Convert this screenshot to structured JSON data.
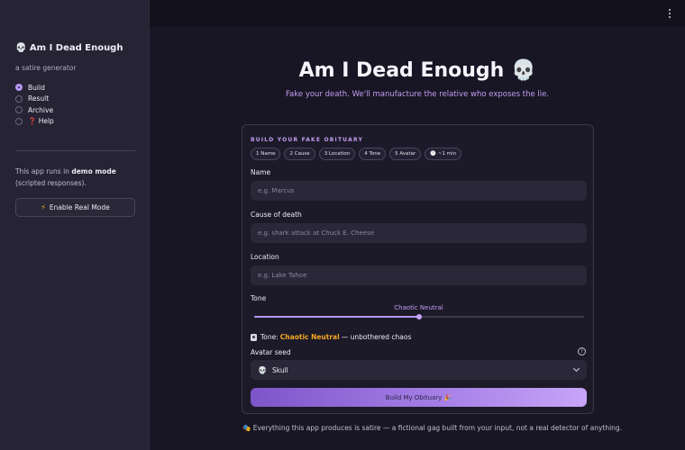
{
  "sidebar": {
    "title": "💀 Am I Dead Enough",
    "subtitle": "a satire generator",
    "nav": [
      {
        "label": "Build",
        "selected": true
      },
      {
        "label": "Result",
        "selected": false
      },
      {
        "label": "Archive",
        "selected": false
      },
      {
        "label": "❓ Help",
        "selected": false
      }
    ],
    "note_prefix": "This app runs in ",
    "note_bold": "demo mode",
    "note_suffix": " (scripted responses).",
    "enable_button": "Enable Real Mode",
    "enable_icon": "⚡"
  },
  "header": {
    "menu_icon": "kebab-menu-icon"
  },
  "hero": {
    "title": "Am I Dead Enough 💀",
    "subtitle": "Fake your death. We'll manufacture the relative who exposes the lie."
  },
  "form": {
    "heading": "BUILD YOUR FAKE OBITUARY",
    "steps": [
      "1 Name",
      "2 Cause",
      "3 Location",
      "4 Tone",
      "5 Avatar",
      "🕐 ~1 min"
    ],
    "name_label": "Name",
    "name_placeholder": "e.g. Marcus",
    "name_value": "",
    "cause_label": "Cause of death",
    "cause_placeholder": "e.g. shark attack at Chuck E. Cheese",
    "cause_value": "",
    "location_label": "Location",
    "location_placeholder": "e.g. Lake Tahoe",
    "location_value": "",
    "tone_label": "Tone",
    "tone_value": "Chaotic Neutral",
    "tone_level": 0.5,
    "tone_line_prefix": "Tone:",
    "tone_line_name": "Chaotic Neutral",
    "tone_line_suffix": "— unbothered chaos",
    "avatar_label": "Avatar seed",
    "avatar_value": "Skull",
    "avatar_icon": "💀",
    "submit": "Build My Obituary 🎉"
  },
  "footer": {
    "text": "🎭 Everything this app produces is satire — a fictional gag built from your input, not a real detector of anything."
  },
  "colors": {
    "accent": "#b796f2",
    "highlight": "#f5a623",
    "background": "#181624",
    "sidebar": "#262335"
  }
}
